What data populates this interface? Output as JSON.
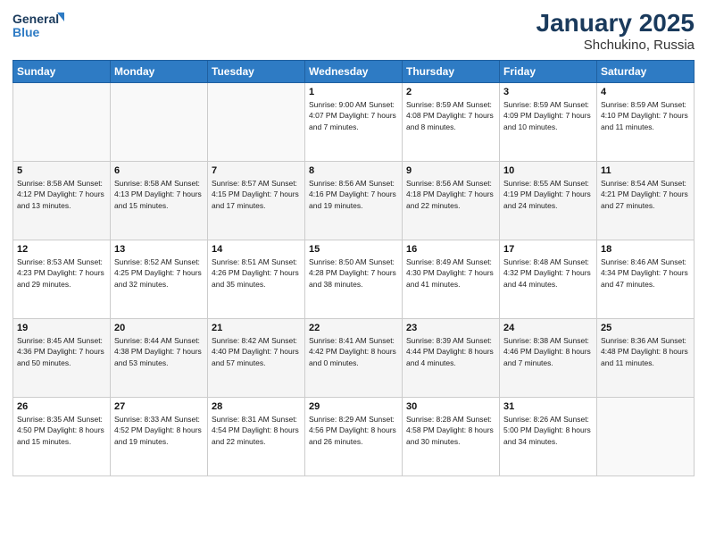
{
  "logo": {
    "line1": "General",
    "line2": "Blue"
  },
  "title": "January 2025",
  "location": "Shchukino, Russia",
  "days_of_week": [
    "Sunday",
    "Monday",
    "Tuesday",
    "Wednesday",
    "Thursday",
    "Friday",
    "Saturday"
  ],
  "weeks": [
    [
      {
        "num": "",
        "content": ""
      },
      {
        "num": "",
        "content": ""
      },
      {
        "num": "",
        "content": ""
      },
      {
        "num": "1",
        "content": "Sunrise: 9:00 AM\nSunset: 4:07 PM\nDaylight: 7 hours\nand 7 minutes."
      },
      {
        "num": "2",
        "content": "Sunrise: 8:59 AM\nSunset: 4:08 PM\nDaylight: 7 hours\nand 8 minutes."
      },
      {
        "num": "3",
        "content": "Sunrise: 8:59 AM\nSunset: 4:09 PM\nDaylight: 7 hours\nand 10 minutes."
      },
      {
        "num": "4",
        "content": "Sunrise: 8:59 AM\nSunset: 4:10 PM\nDaylight: 7 hours\nand 11 minutes."
      }
    ],
    [
      {
        "num": "5",
        "content": "Sunrise: 8:58 AM\nSunset: 4:12 PM\nDaylight: 7 hours\nand 13 minutes."
      },
      {
        "num": "6",
        "content": "Sunrise: 8:58 AM\nSunset: 4:13 PM\nDaylight: 7 hours\nand 15 minutes."
      },
      {
        "num": "7",
        "content": "Sunrise: 8:57 AM\nSunset: 4:15 PM\nDaylight: 7 hours\nand 17 minutes."
      },
      {
        "num": "8",
        "content": "Sunrise: 8:56 AM\nSunset: 4:16 PM\nDaylight: 7 hours\nand 19 minutes."
      },
      {
        "num": "9",
        "content": "Sunrise: 8:56 AM\nSunset: 4:18 PM\nDaylight: 7 hours\nand 22 minutes."
      },
      {
        "num": "10",
        "content": "Sunrise: 8:55 AM\nSunset: 4:19 PM\nDaylight: 7 hours\nand 24 minutes."
      },
      {
        "num": "11",
        "content": "Sunrise: 8:54 AM\nSunset: 4:21 PM\nDaylight: 7 hours\nand 27 minutes."
      }
    ],
    [
      {
        "num": "12",
        "content": "Sunrise: 8:53 AM\nSunset: 4:23 PM\nDaylight: 7 hours\nand 29 minutes."
      },
      {
        "num": "13",
        "content": "Sunrise: 8:52 AM\nSunset: 4:25 PM\nDaylight: 7 hours\nand 32 minutes."
      },
      {
        "num": "14",
        "content": "Sunrise: 8:51 AM\nSunset: 4:26 PM\nDaylight: 7 hours\nand 35 minutes."
      },
      {
        "num": "15",
        "content": "Sunrise: 8:50 AM\nSunset: 4:28 PM\nDaylight: 7 hours\nand 38 minutes."
      },
      {
        "num": "16",
        "content": "Sunrise: 8:49 AM\nSunset: 4:30 PM\nDaylight: 7 hours\nand 41 minutes."
      },
      {
        "num": "17",
        "content": "Sunrise: 8:48 AM\nSunset: 4:32 PM\nDaylight: 7 hours\nand 44 minutes."
      },
      {
        "num": "18",
        "content": "Sunrise: 8:46 AM\nSunset: 4:34 PM\nDaylight: 7 hours\nand 47 minutes."
      }
    ],
    [
      {
        "num": "19",
        "content": "Sunrise: 8:45 AM\nSunset: 4:36 PM\nDaylight: 7 hours\nand 50 minutes."
      },
      {
        "num": "20",
        "content": "Sunrise: 8:44 AM\nSunset: 4:38 PM\nDaylight: 7 hours\nand 53 minutes."
      },
      {
        "num": "21",
        "content": "Sunrise: 8:42 AM\nSunset: 4:40 PM\nDaylight: 7 hours\nand 57 minutes."
      },
      {
        "num": "22",
        "content": "Sunrise: 8:41 AM\nSunset: 4:42 PM\nDaylight: 8 hours\nand 0 minutes."
      },
      {
        "num": "23",
        "content": "Sunrise: 8:39 AM\nSunset: 4:44 PM\nDaylight: 8 hours\nand 4 minutes."
      },
      {
        "num": "24",
        "content": "Sunrise: 8:38 AM\nSunset: 4:46 PM\nDaylight: 8 hours\nand 7 minutes."
      },
      {
        "num": "25",
        "content": "Sunrise: 8:36 AM\nSunset: 4:48 PM\nDaylight: 8 hours\nand 11 minutes."
      }
    ],
    [
      {
        "num": "26",
        "content": "Sunrise: 8:35 AM\nSunset: 4:50 PM\nDaylight: 8 hours\nand 15 minutes."
      },
      {
        "num": "27",
        "content": "Sunrise: 8:33 AM\nSunset: 4:52 PM\nDaylight: 8 hours\nand 19 minutes."
      },
      {
        "num": "28",
        "content": "Sunrise: 8:31 AM\nSunset: 4:54 PM\nDaylight: 8 hours\nand 22 minutes."
      },
      {
        "num": "29",
        "content": "Sunrise: 8:29 AM\nSunset: 4:56 PM\nDaylight: 8 hours\nand 26 minutes."
      },
      {
        "num": "30",
        "content": "Sunrise: 8:28 AM\nSunset: 4:58 PM\nDaylight: 8 hours\nand 30 minutes."
      },
      {
        "num": "31",
        "content": "Sunrise: 8:26 AM\nSunset: 5:00 PM\nDaylight: 8 hours\nand 34 minutes."
      },
      {
        "num": "",
        "content": ""
      }
    ]
  ]
}
